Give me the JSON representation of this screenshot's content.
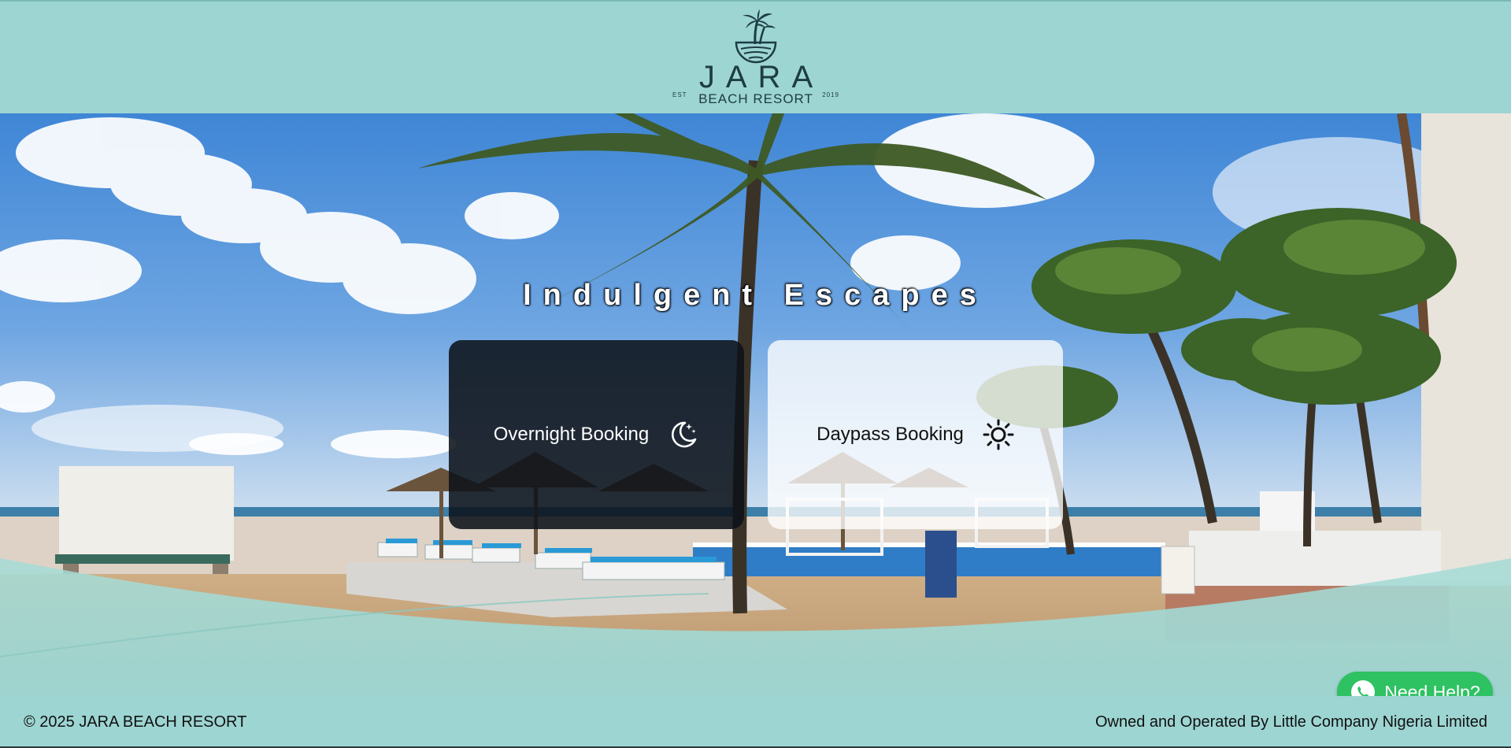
{
  "header": {
    "logo": {
      "name": "JARA",
      "subtitle": "BEACH RESORT",
      "est": "EST",
      "year": "2019",
      "icon": "palm-tree-icon"
    }
  },
  "hero": {
    "title": "Indulgent Escapes",
    "cards": [
      {
        "label": "Overnight Booking",
        "icon": "moon-stars-icon"
      },
      {
        "label": "Daypass Booking",
        "icon": "sun-icon"
      }
    ]
  },
  "help_button": {
    "label": "Need Help?",
    "icon": "whatsapp-icon",
    "color": "#2ec262"
  },
  "footer": {
    "copyright": "© 2025 JARA BEACH RESORT",
    "operator": "Owned and Operated By Little Company Nigeria Limited"
  },
  "colors": {
    "brand_teal": "#9dd5d2",
    "logo_dark": "#1d3c44"
  }
}
